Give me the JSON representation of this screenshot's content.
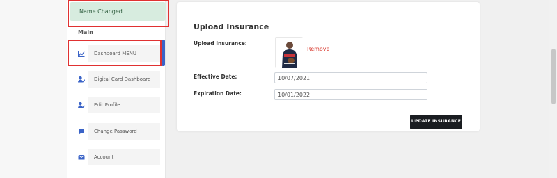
{
  "alert": {
    "text": "Name Changed"
  },
  "sidebar": {
    "section_label": "Main",
    "items": [
      {
        "label": "Dashboard  MENU",
        "icon": "chart-line-icon"
      },
      {
        "label": "Digital Card Dashboard",
        "icon": "user-card-icon"
      },
      {
        "label": "Edit Profile",
        "icon": "user-edit-icon"
      },
      {
        "label": "Change Password",
        "icon": "chat-bubble-icon"
      },
      {
        "label": "Account",
        "icon": "envelope-icon"
      }
    ]
  },
  "card": {
    "title": "Upload Insurance",
    "upload_label": "Upload Insurance:",
    "remove_label": "Remove",
    "effective_label": "Effective Date:",
    "effective_value": "10/07/2021",
    "expiration_label": "Expiration Date:",
    "expiration_value": "10/01/2022",
    "button_label": "UPDATE INSURANCE"
  },
  "colors": {
    "accent": "#3a63c7",
    "alert_bg": "#d7ecdf",
    "danger": "#d9362b",
    "button": "#1a1d21"
  }
}
